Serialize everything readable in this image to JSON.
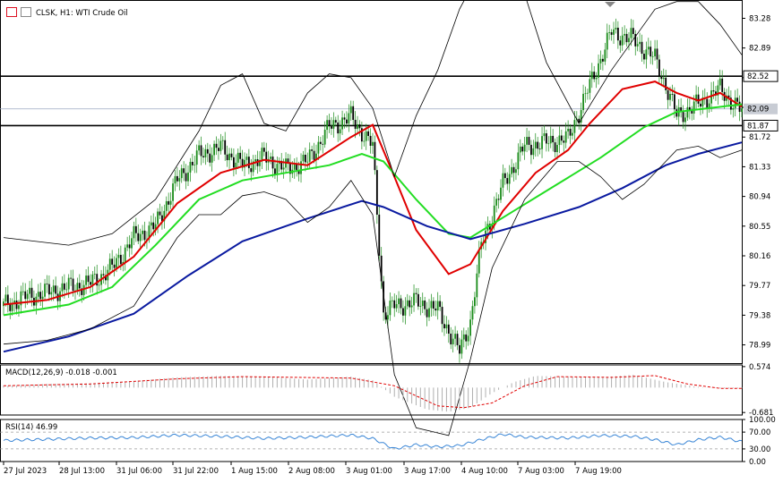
{
  "header": {
    "symbol_line": "CLSK, H1:  WTI Crude Oil",
    "icons": [
      "grid-icon",
      "chart-settings-icon"
    ]
  },
  "colors": {
    "candle": "#1a8c1a",
    "bollinger": "#000000",
    "ma_fast": "#e00000",
    "ma_mid": "#22dd22",
    "ma_slow": "#0a1aa0",
    "macd_hist": "#b0b0b0",
    "macd_signal": "#e00000",
    "rsi": "#3a86d6"
  },
  "chart_data": [
    {
      "type": "candlestick",
      "panel": "price",
      "ylim": [
        78.75,
        83.45
      ],
      "price_ticks": [
        "83.28",
        "82.89",
        "82.52",
        "82.09",
        "81.72",
        "81.33",
        "80.94",
        "80.55",
        "80.16",
        "79.77",
        "79.38",
        "78.99"
      ],
      "tick_values": [
        83.28,
        82.89,
        82.5,
        82.11,
        81.72,
        81.33,
        80.94,
        80.55,
        80.16,
        79.77,
        79.38,
        78.99
      ],
      "horizontal_lines": [
        {
          "label": "82.52",
          "value": 82.52
        },
        {
          "label": "81.87",
          "value": 81.87
        }
      ],
      "current_price": {
        "label": "82.09",
        "value": 82.09
      },
      "x_labels": [
        "27 Jul 2023",
        "28 Jul 13:00",
        "31 Jul 06:00",
        "31 Jul 22:00",
        "1 Aug 15:00",
        "2 Aug 08:00",
        "3 Aug 01:00",
        "3 Aug 17:00",
        "4 Aug 10:00",
        "7 Aug 03:00",
        "7 Aug 19:00"
      ],
      "close_path": [
        [
          0,
          79.5
        ],
        [
          10,
          79.62
        ],
        [
          20,
          79.68
        ],
        [
          30,
          79.75
        ],
        [
          40,
          79.8
        ],
        [
          50,
          80.0
        ],
        [
          60,
          80.4
        ],
        [
          70,
          80.55
        ],
        [
          80,
          81.15
        ],
        [
          90,
          81.48
        ],
        [
          100,
          81.58
        ],
        [
          110,
          81.35
        ],
        [
          120,
          81.45
        ],
        [
          130,
          81.3
        ],
        [
          140,
          81.4
        ],
        [
          150,
          81.85
        ],
        [
          160,
          81.98
        ],
        [
          170,
          81.6
        ],
        [
          175,
          79.4
        ],
        [
          180,
          79.5
        ],
        [
          190,
          79.55
        ],
        [
          200,
          79.45
        ],
        [
          210,
          78.9
        ],
        [
          215,
          79.3
        ],
        [
          220,
          80.3
        ],
        [
          230,
          81.1
        ],
        [
          240,
          81.6
        ],
        [
          250,
          81.65
        ],
        [
          260,
          81.7
        ],
        [
          270,
          82.4
        ],
        [
          280,
          83.1
        ],
        [
          290,
          83.0
        ],
        [
          300,
          82.75
        ],
        [
          305,
          82.4
        ],
        [
          310,
          82.0
        ],
        [
          320,
          82.15
        ],
        [
          330,
          82.35
        ],
        [
          340,
          82.05
        ]
      ],
      "series": [
        {
          "name": "",
          "type": "ma",
          "color_key": "ma_fast",
          "points": [
            [
              0,
              79.52
            ],
            [
              20,
              79.58
            ],
            [
              40,
              79.75
            ],
            [
              60,
              80.15
            ],
            [
              80,
              80.85
            ],
            [
              100,
              81.25
            ],
            [
              120,
              81.42
            ],
            [
              140,
              81.35
            ],
            [
              160,
              81.72
            ],
            [
              170,
              81.88
            ],
            [
              180,
              81.2
            ],
            [
              190,
              80.5
            ],
            [
              205,
              79.92
            ],
            [
              215,
              80.05
            ],
            [
              230,
              80.75
            ],
            [
              245,
              81.25
            ],
            [
              260,
              81.55
            ],
            [
              270,
              81.9
            ],
            [
              285,
              82.35
            ],
            [
              300,
              82.45
            ],
            [
              310,
              82.3
            ],
            [
              320,
              82.2
            ],
            [
              330,
              82.3
            ],
            [
              340,
              82.12
            ]
          ]
        },
        {
          "name": "",
          "type": "ma",
          "color_key": "ma_mid",
          "points": [
            [
              0,
              79.38
            ],
            [
              30,
              79.52
            ],
            [
              50,
              79.75
            ],
            [
              70,
              80.3
            ],
            [
              90,
              80.9
            ],
            [
              110,
              81.15
            ],
            [
              130,
              81.25
            ],
            [
              150,
              81.35
            ],
            [
              165,
              81.5
            ],
            [
              175,
              81.4
            ],
            [
              190,
              80.9
            ],
            [
              205,
              80.45
            ],
            [
              215,
              80.4
            ],
            [
              235,
              80.75
            ],
            [
              255,
              81.1
            ],
            [
              275,
              81.45
            ],
            [
              295,
              81.85
            ],
            [
              310,
              82.05
            ],
            [
              325,
              82.1
            ],
            [
              340,
              82.15
            ]
          ]
        },
        {
          "name": "",
          "type": "ma",
          "color_key": "ma_slow",
          "points": [
            [
              0,
              78.9
            ],
            [
              30,
              79.1
            ],
            [
              60,
              79.4
            ],
            [
              85,
              79.9
            ],
            [
              110,
              80.35
            ],
            [
              140,
              80.65
            ],
            [
              165,
              80.88
            ],
            [
              175,
              80.8
            ],
            [
              195,
              80.55
            ],
            [
              215,
              80.38
            ],
            [
              240,
              80.58
            ],
            [
              265,
              80.8
            ],
            [
              285,
              81.05
            ],
            [
              305,
              81.35
            ],
            [
              320,
              81.5
            ],
            [
              340,
              81.65
            ]
          ]
        },
        {
          "name": "",
          "type": "bollinger_upper",
          "color_key": "bollinger",
          "points": [
            [
              0,
              80.4
            ],
            [
              30,
              80.3
            ],
            [
              50,
              80.45
            ],
            [
              70,
              80.9
            ],
            [
              90,
              81.8
            ],
            [
              100,
              82.4
            ],
            [
              110,
              82.55
            ],
            [
              120,
              81.9
            ],
            [
              130,
              81.8
            ],
            [
              140,
              82.3
            ],
            [
              150,
              82.55
            ],
            [
              160,
              82.5
            ],
            [
              170,
              82.1
            ],
            [
              180,
              81.2
            ],
            [
              190,
              82.0
            ],
            [
              200,
              82.6
            ],
            [
              210,
              83.4
            ],
            [
              225,
              84.2
            ],
            [
              240,
              83.6
            ],
            [
              250,
              82.7
            ],
            [
              265,
              81.9
            ],
            [
              280,
              82.6
            ],
            [
              290,
              83.0
            ],
            [
              300,
              83.4
            ],
            [
              310,
              83.5
            ],
            [
              320,
              83.5
            ],
            [
              330,
              83.2
            ],
            [
              340,
              82.8
            ]
          ]
        },
        {
          "name": "",
          "type": "bollinger_lower",
          "color_key": "bollinger",
          "points": [
            [
              0,
              79.0
            ],
            [
              20,
              79.05
            ],
            [
              40,
              79.2
            ],
            [
              60,
              79.5
            ],
            [
              80,
              80.4
            ],
            [
              90,
              80.7
            ],
            [
              100,
              80.7
            ],
            [
              110,
              80.95
            ],
            [
              120,
              81.0
            ],
            [
              130,
              80.9
            ],
            [
              140,
              80.6
            ],
            [
              150,
              80.8
            ],
            [
              160,
              81.15
            ],
            [
              170,
              80.7
            ],
            [
              180,
              78.6
            ],
            [
              190,
              77.9
            ],
            [
              205,
              77.8
            ],
            [
              215,
              78.8
            ],
            [
              225,
              80.0
            ],
            [
              240,
              80.9
            ],
            [
              255,
              81.4
            ],
            [
              265,
              81.4
            ],
            [
              275,
              81.2
            ],
            [
              285,
              80.9
            ],
            [
              295,
              81.1
            ],
            [
              310,
              81.55
            ],
            [
              320,
              81.6
            ],
            [
              330,
              81.45
            ],
            [
              340,
              81.55
            ]
          ]
        }
      ]
    },
    {
      "type": "histogram",
      "panel": "macd",
      "label": "MACD(12,26,9) -0.018 -0.001",
      "ticks": [
        "0.574",
        "-0.681"
      ],
      "ylim": [
        -0.75,
        0.62
      ],
      "histogram": [
        [
          0,
          0.05
        ],
        [
          20,
          0.1
        ],
        [
          40,
          0.12
        ],
        [
          60,
          0.18
        ],
        [
          80,
          0.28
        ],
        [
          100,
          0.32
        ],
        [
          120,
          0.3
        ],
        [
          140,
          0.22
        ],
        [
          160,
          0.3
        ],
        [
          170,
          0.2
        ],
        [
          180,
          -0.25
        ],
        [
          195,
          -0.6
        ],
        [
          205,
          -0.66
        ],
        [
          215,
          -0.55
        ],
        [
          225,
          -0.15
        ],
        [
          235,
          0.15
        ],
        [
          245,
          0.32
        ],
        [
          260,
          0.3
        ],
        [
          275,
          0.28
        ],
        [
          290,
          0.35
        ],
        [
          305,
          0.15
        ],
        [
          320,
          0.02
        ],
        [
          330,
          -0.02
        ],
        [
          340,
          -0.02
        ]
      ],
      "signal": [
        [
          0,
          0.05
        ],
        [
          40,
          0.1
        ],
        [
          80,
          0.24
        ],
        [
          110,
          0.3
        ],
        [
          160,
          0.26
        ],
        [
          180,
          0.05
        ],
        [
          200,
          -0.5
        ],
        [
          212,
          -0.55
        ],
        [
          225,
          -0.42
        ],
        [
          240,
          0.05
        ],
        [
          255,
          0.3
        ],
        [
          280,
          0.28
        ],
        [
          300,
          0.33
        ],
        [
          315,
          0.1
        ],
        [
          330,
          -0.02
        ],
        [
          340,
          -0.02
        ]
      ]
    },
    {
      "type": "line",
      "panel": "rsi",
      "label": "RSI(14) 46.99",
      "ticks": [
        "100.00",
        "70.00",
        "30.00",
        "0.00"
      ],
      "levels": [
        70,
        30
      ],
      "ylim": [
        0,
        100
      ],
      "values": [
        [
          0,
          50
        ],
        [
          20,
          53
        ],
        [
          40,
          56
        ],
        [
          60,
          57
        ],
        [
          80,
          63
        ],
        [
          100,
          60
        ],
        [
          120,
          55
        ],
        [
          140,
          58
        ],
        [
          160,
          63
        ],
        [
          170,
          55
        ],
        [
          180,
          30
        ],
        [
          190,
          40
        ],
        [
          200,
          35
        ],
        [
          210,
          38
        ],
        [
          220,
          52
        ],
        [
          230,
          65
        ],
        [
          240,
          58
        ],
        [
          260,
          56
        ],
        [
          275,
          62
        ],
        [
          290,
          60
        ],
        [
          300,
          52
        ],
        [
          310,
          40
        ],
        [
          320,
          52
        ],
        [
          330,
          58
        ],
        [
          340,
          47
        ]
      ]
    }
  ]
}
